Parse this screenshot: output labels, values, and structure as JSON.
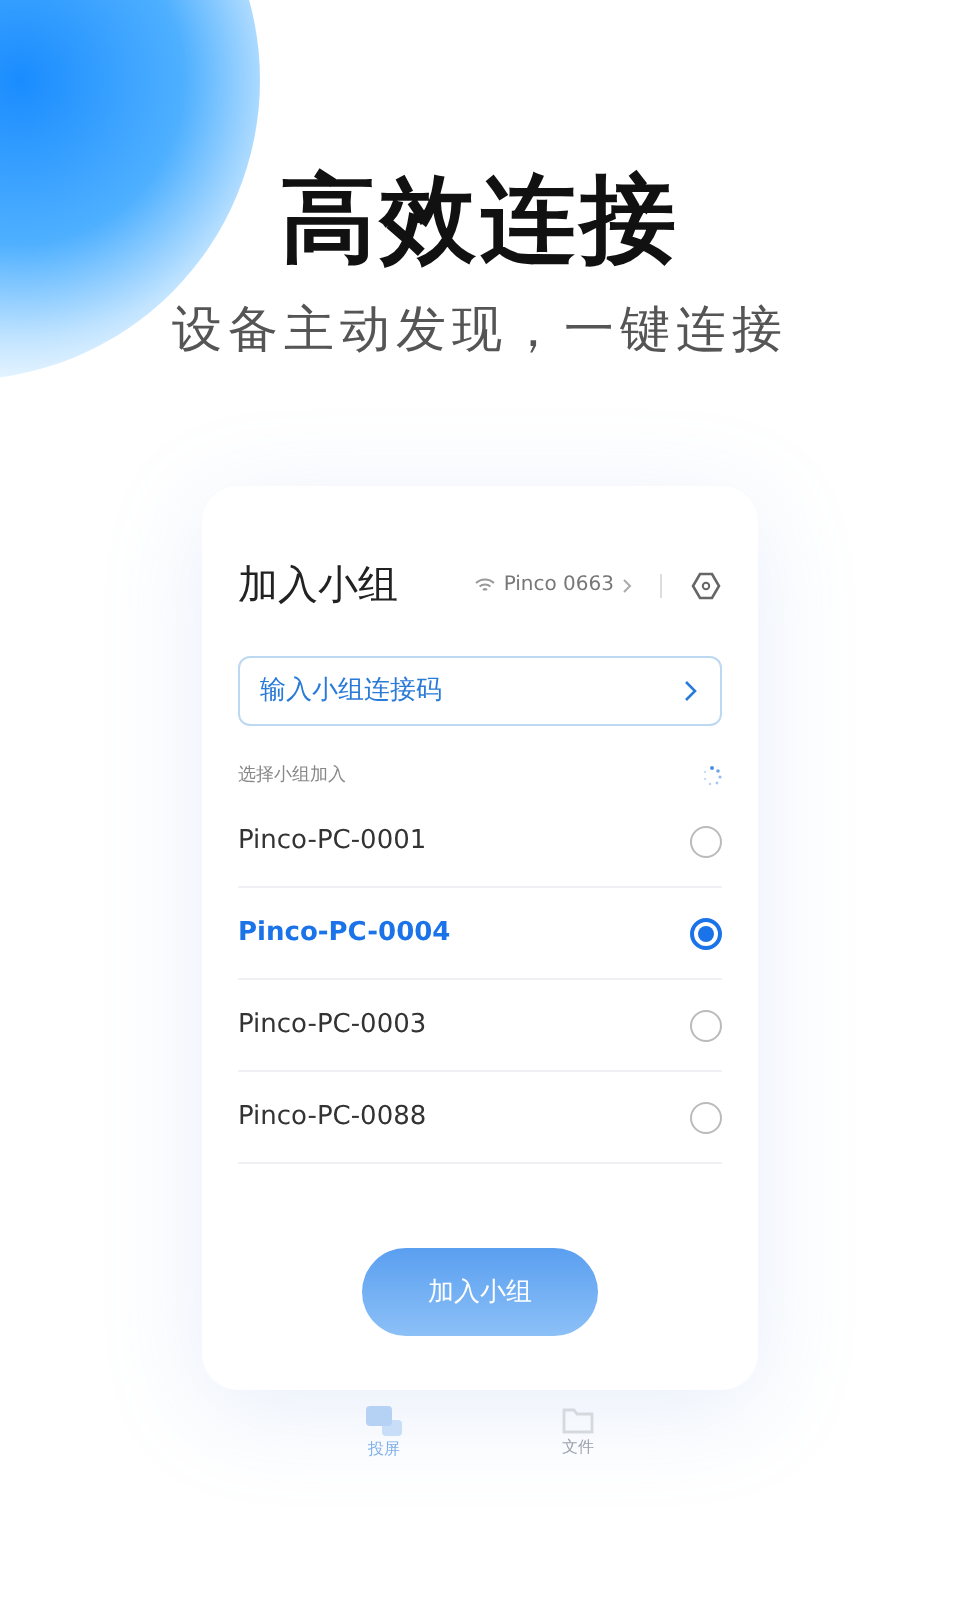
{
  "headline": "高效连接",
  "subtitle": "设备主动发现，一键连接",
  "card": {
    "title": "加入小组",
    "network": "Pinco 0663",
    "code_field": {
      "placeholder": "输入小组连接码"
    },
    "section_label": "选择小组加入",
    "groups": [
      {
        "name": "Pinco-PC-0001",
        "selected": false
      },
      {
        "name": "Pinco-PC-0004",
        "selected": true
      },
      {
        "name": "Pinco-PC-0003",
        "selected": false
      },
      {
        "name": "Pinco-PC-0088",
        "selected": false
      }
    ],
    "join_button": "加入小组"
  },
  "tabs": [
    {
      "label": "投屏",
      "kind": "screen",
      "selected": true
    },
    {
      "label": "文件",
      "kind": "folder",
      "selected": false
    }
  ]
}
